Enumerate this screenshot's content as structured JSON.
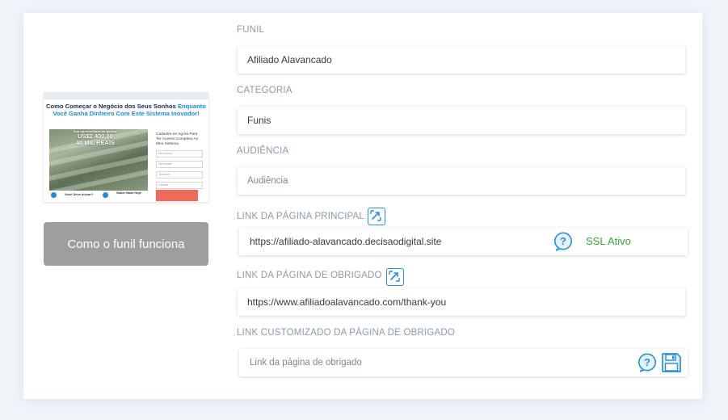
{
  "preview": {
    "headline_dark": "Como Começar o Negócio dos Seus Sonhos",
    "headline_blue_1": "Enquanto",
    "headline_blue_2": "Você Ganha Dinheiro Com Este Sistema Inovador!",
    "promo_small": "Sua oportunidade de ganhar",
    "promo_amount": "US$2.400,00",
    "promo_sub": "40 MIL REAIS",
    "form_text": "Cadastre-se Agora Para Ter Acesso Completo Ao Meu Sistema",
    "input_1": "Seu nome",
    "input_2": "Seu email",
    "input_3": "Telefone",
    "input_4": "Celular",
    "foot_1": "Você Deve Iniciar?",
    "foot_2": "Saber Mais Hoje"
  },
  "how_button": "Como o funil funciona",
  "fields": {
    "funil_label": "FUNIL",
    "funil_value": "Afiliado Alavancado",
    "categoria_label": "CATEGORIA",
    "categoria_value": "Funis",
    "audiencia_label": "AUDIÊNCIA",
    "audiencia_placeholder": "Audiência",
    "link_principal_label": "LINK DA PÁGINA PRINCIPAL",
    "link_principal_value": "https://afiliado-alavancado.decisaodigital.site",
    "ssl_status": "SSL Ativo",
    "link_obrigado_label": "LINK DA PÁGINA DE OBRIGADO",
    "link_obrigado_value": "https://www.afiliadoalavancado.com/thank-you",
    "link_custom_label": "LINK CUSTOMIZADO DA PÁGINA DE OBRIGADO",
    "link_custom_placeholder": "Link da página de obrigado"
  },
  "colors": {
    "accent_blue": "#2c8fce",
    "ssl_green": "#3aa23a",
    "button_gray": "#9e9e9e",
    "label_gray": "#8d9aa9"
  },
  "icons": {
    "open_link": "external-link-icon",
    "help": "question-icon",
    "save": "floppy-disk-icon"
  }
}
